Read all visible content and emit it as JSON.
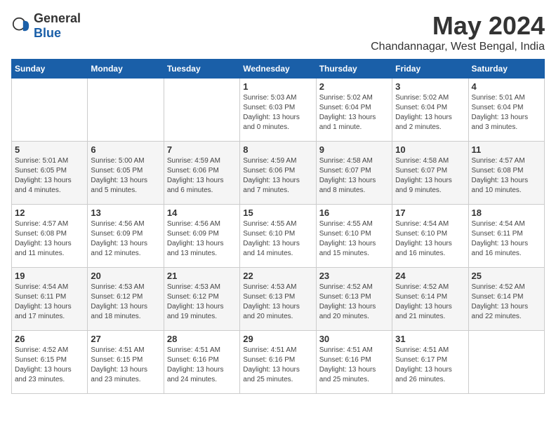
{
  "header": {
    "logo_general": "General",
    "logo_blue": "Blue",
    "month": "May 2024",
    "location": "Chandannagar, West Bengal, India"
  },
  "days_of_week": [
    "Sunday",
    "Monday",
    "Tuesday",
    "Wednesday",
    "Thursday",
    "Friday",
    "Saturday"
  ],
  "weeks": [
    [
      {
        "day": "",
        "info": ""
      },
      {
        "day": "",
        "info": ""
      },
      {
        "day": "",
        "info": ""
      },
      {
        "day": "1",
        "info": "Sunrise: 5:03 AM\nSunset: 6:03 PM\nDaylight: 13 hours\nand 0 minutes."
      },
      {
        "day": "2",
        "info": "Sunrise: 5:02 AM\nSunset: 6:04 PM\nDaylight: 13 hours\nand 1 minute."
      },
      {
        "day": "3",
        "info": "Sunrise: 5:02 AM\nSunset: 6:04 PM\nDaylight: 13 hours\nand 2 minutes."
      },
      {
        "day": "4",
        "info": "Sunrise: 5:01 AM\nSunset: 6:04 PM\nDaylight: 13 hours\nand 3 minutes."
      }
    ],
    [
      {
        "day": "5",
        "info": "Sunrise: 5:01 AM\nSunset: 6:05 PM\nDaylight: 13 hours\nand 4 minutes."
      },
      {
        "day": "6",
        "info": "Sunrise: 5:00 AM\nSunset: 6:05 PM\nDaylight: 13 hours\nand 5 minutes."
      },
      {
        "day": "7",
        "info": "Sunrise: 4:59 AM\nSunset: 6:06 PM\nDaylight: 13 hours\nand 6 minutes."
      },
      {
        "day": "8",
        "info": "Sunrise: 4:59 AM\nSunset: 6:06 PM\nDaylight: 13 hours\nand 7 minutes."
      },
      {
        "day": "9",
        "info": "Sunrise: 4:58 AM\nSunset: 6:07 PM\nDaylight: 13 hours\nand 8 minutes."
      },
      {
        "day": "10",
        "info": "Sunrise: 4:58 AM\nSunset: 6:07 PM\nDaylight: 13 hours\nand 9 minutes."
      },
      {
        "day": "11",
        "info": "Sunrise: 4:57 AM\nSunset: 6:08 PM\nDaylight: 13 hours\nand 10 minutes."
      }
    ],
    [
      {
        "day": "12",
        "info": "Sunrise: 4:57 AM\nSunset: 6:08 PM\nDaylight: 13 hours\nand 11 minutes."
      },
      {
        "day": "13",
        "info": "Sunrise: 4:56 AM\nSunset: 6:09 PM\nDaylight: 13 hours\nand 12 minutes."
      },
      {
        "day": "14",
        "info": "Sunrise: 4:56 AM\nSunset: 6:09 PM\nDaylight: 13 hours\nand 13 minutes."
      },
      {
        "day": "15",
        "info": "Sunrise: 4:55 AM\nSunset: 6:10 PM\nDaylight: 13 hours\nand 14 minutes."
      },
      {
        "day": "16",
        "info": "Sunrise: 4:55 AM\nSunset: 6:10 PM\nDaylight: 13 hours\nand 15 minutes."
      },
      {
        "day": "17",
        "info": "Sunrise: 4:54 AM\nSunset: 6:10 PM\nDaylight: 13 hours\nand 16 minutes."
      },
      {
        "day": "18",
        "info": "Sunrise: 4:54 AM\nSunset: 6:11 PM\nDaylight: 13 hours\nand 16 minutes."
      }
    ],
    [
      {
        "day": "19",
        "info": "Sunrise: 4:54 AM\nSunset: 6:11 PM\nDaylight: 13 hours\nand 17 minutes."
      },
      {
        "day": "20",
        "info": "Sunrise: 4:53 AM\nSunset: 6:12 PM\nDaylight: 13 hours\nand 18 minutes."
      },
      {
        "day": "21",
        "info": "Sunrise: 4:53 AM\nSunset: 6:12 PM\nDaylight: 13 hours\nand 19 minutes."
      },
      {
        "day": "22",
        "info": "Sunrise: 4:53 AM\nSunset: 6:13 PM\nDaylight: 13 hours\nand 20 minutes."
      },
      {
        "day": "23",
        "info": "Sunrise: 4:52 AM\nSunset: 6:13 PM\nDaylight: 13 hours\nand 20 minutes."
      },
      {
        "day": "24",
        "info": "Sunrise: 4:52 AM\nSunset: 6:14 PM\nDaylight: 13 hours\nand 21 minutes."
      },
      {
        "day": "25",
        "info": "Sunrise: 4:52 AM\nSunset: 6:14 PM\nDaylight: 13 hours\nand 22 minutes."
      }
    ],
    [
      {
        "day": "26",
        "info": "Sunrise: 4:52 AM\nSunset: 6:15 PM\nDaylight: 13 hours\nand 23 minutes."
      },
      {
        "day": "27",
        "info": "Sunrise: 4:51 AM\nSunset: 6:15 PM\nDaylight: 13 hours\nand 23 minutes."
      },
      {
        "day": "28",
        "info": "Sunrise: 4:51 AM\nSunset: 6:16 PM\nDaylight: 13 hours\nand 24 minutes."
      },
      {
        "day": "29",
        "info": "Sunrise: 4:51 AM\nSunset: 6:16 PM\nDaylight: 13 hours\nand 25 minutes."
      },
      {
        "day": "30",
        "info": "Sunrise: 4:51 AM\nSunset: 6:16 PM\nDaylight: 13 hours\nand 25 minutes."
      },
      {
        "day": "31",
        "info": "Sunrise: 4:51 AM\nSunset: 6:17 PM\nDaylight: 13 hours\nand 26 minutes."
      },
      {
        "day": "",
        "info": ""
      }
    ]
  ]
}
